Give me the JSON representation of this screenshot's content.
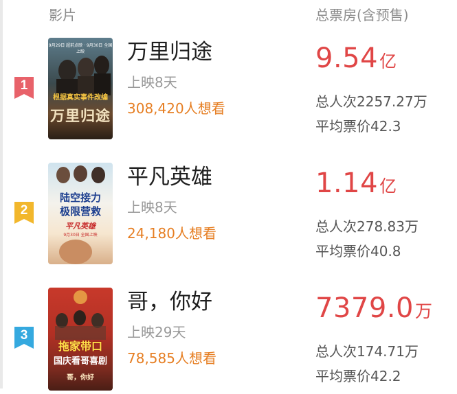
{
  "header": {
    "movie_label": "影片",
    "box_office_label": "总票房(含预售)"
  },
  "colors": {
    "rank1": "#e8626a",
    "rank2": "#f2b72c",
    "rank3": "#35a9df",
    "gross": "#e04646",
    "want": "#e67e22"
  },
  "movies": [
    {
      "rank": "1",
      "title": "万里归途",
      "days": "上映8天",
      "want": "308,420人想看",
      "gross_value": "9.54",
      "gross_unit": "亿",
      "total_viewers": "总人次2257.27万",
      "avg_price": "平均票价42.3",
      "poster": {
        "top_text": "9月29日 超前点映 · 9月30日 全国上映",
        "mid_text": "根据真实事件改编",
        "big_text": "万里归途"
      }
    },
    {
      "rank": "2",
      "title": "平凡英雄",
      "days": "上映8天",
      "want": "24,180人想看",
      "gross_value": "1.14",
      "gross_unit": "亿",
      "total_viewers": "总人次278.83万",
      "avg_price": "平均票价40.8",
      "poster": {
        "line1": "陆空接力",
        "line2": "极限营救",
        "logo": "平凡英雄",
        "date": "9月30日 全国上映"
      }
    },
    {
      "rank": "3",
      "title": "哥，你好",
      "days": "上映29天",
      "want": "78,585人想看",
      "gross_value": "7379.0",
      "gross_unit": "万",
      "total_viewers": "总人次174.71万",
      "avg_price": "平均票价42.2",
      "poster": {
        "line1": "拖家带口",
        "line2": "国庆看哥喜剧",
        "logo": "哥，你好"
      }
    }
  ]
}
